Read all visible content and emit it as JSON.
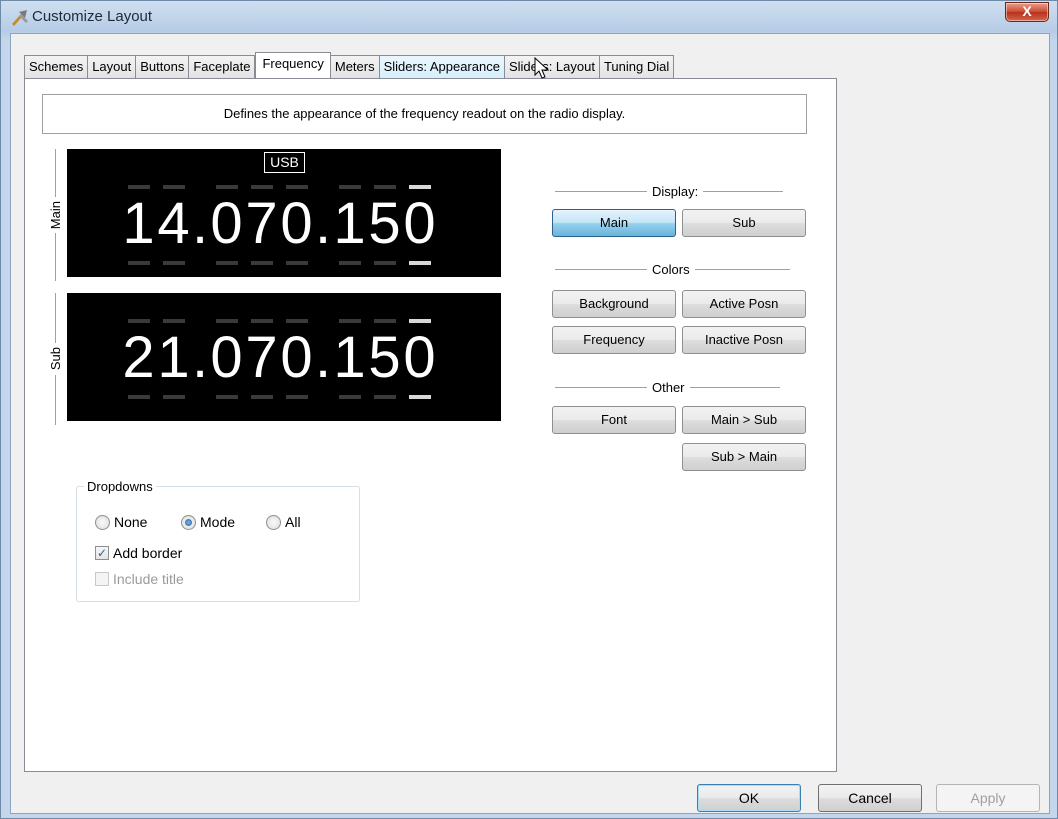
{
  "window": {
    "title": "Customize Layout",
    "close_glyph": "X"
  },
  "tabs": [
    {
      "label": "Schemes"
    },
    {
      "label": "Layout"
    },
    {
      "label": "Buttons"
    },
    {
      "label": "Faceplate"
    },
    {
      "label": "Frequency",
      "active": true
    },
    {
      "label": "Meters"
    },
    {
      "label": "Sliders: Appearance",
      "hover": true
    },
    {
      "label": "Sliders: Layout"
    },
    {
      "label": "Tuning Dial"
    }
  ],
  "panel": {
    "description": "Defines the appearance of the frequency readout on the radio display.",
    "main_display": {
      "side_label": "Main",
      "mode": "USB",
      "frequency": "14.070.150"
    },
    "sub_display": {
      "side_label": "Sub",
      "frequency": "21.070.150"
    },
    "display_group": {
      "title": "Display:",
      "main_button": "Main",
      "sub_button": "Sub"
    },
    "colors_group": {
      "title": "Colors",
      "background_button": "Background",
      "active_posn_button": "Active Posn",
      "frequency_button": "Frequency",
      "inactive_posn_button": "Inactive Posn"
    },
    "other_group": {
      "title": "Other",
      "font_button": "Font",
      "main_to_sub_button": "Main > Sub",
      "sub_to_main_button": "Sub > Main"
    },
    "dropdowns": {
      "title": "Dropdowns",
      "none_label": "None",
      "mode_label": "Mode",
      "all_label": "All",
      "selected": "Mode",
      "add_border_label": "Add border",
      "add_border_checked": true,
      "include_title_label": "Include title",
      "include_title_enabled": false
    }
  },
  "footer": {
    "ok": "OK",
    "cancel": "Cancel",
    "apply": "Apply"
  },
  "colors": {
    "display_bg": "#000000",
    "accent": "#68b3db"
  }
}
